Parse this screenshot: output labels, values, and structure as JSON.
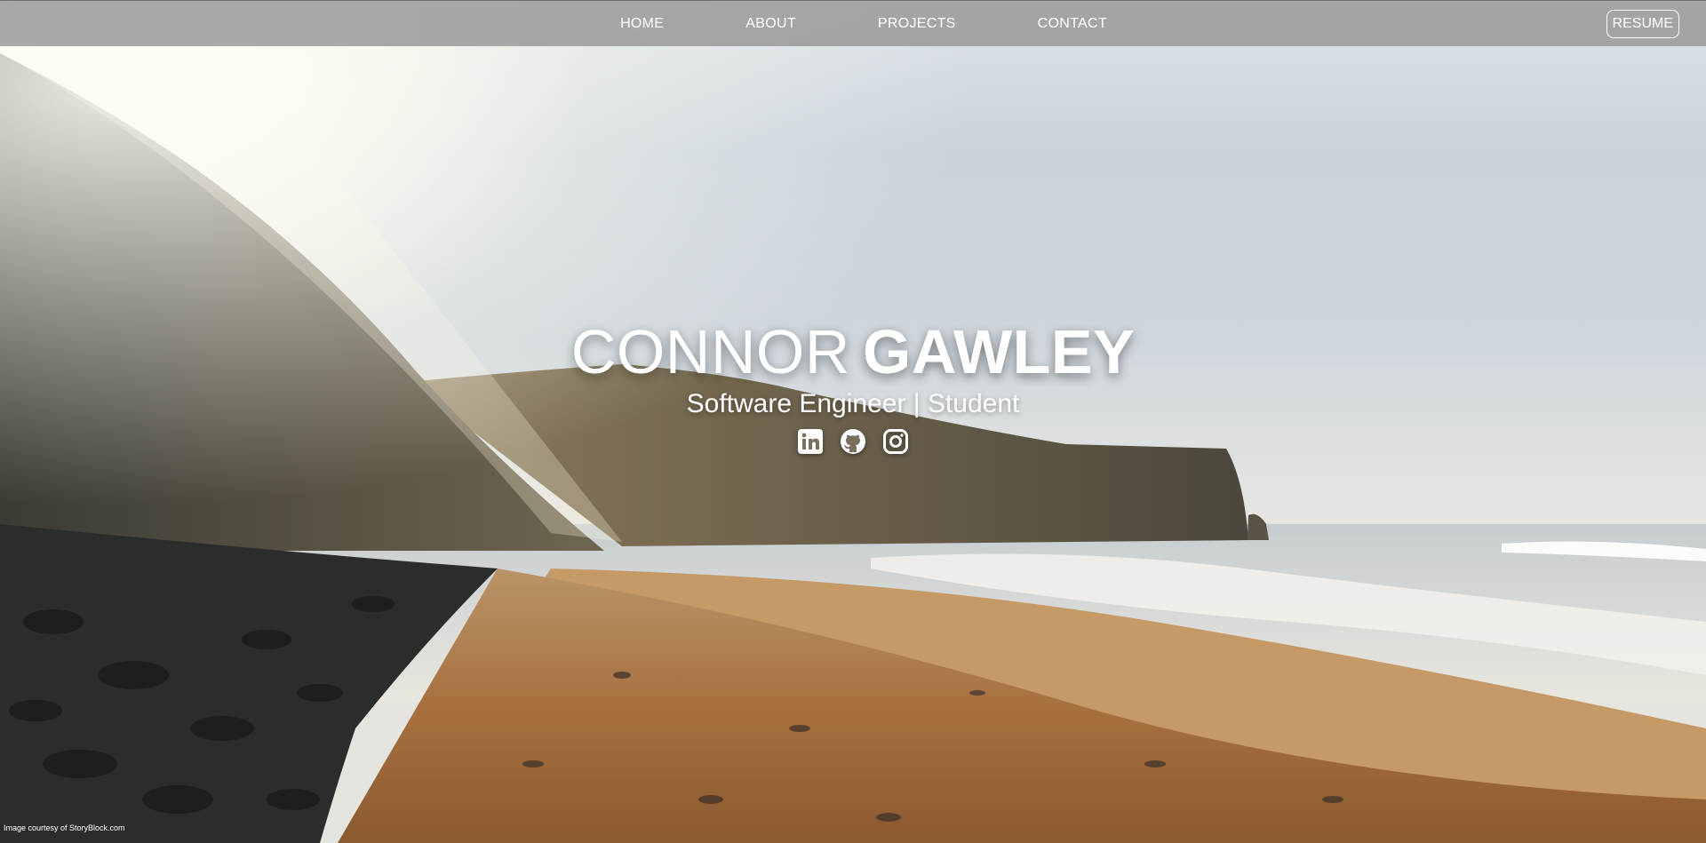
{
  "nav": {
    "links": [
      "HOME",
      "ABOUT",
      "PROJECTS",
      "CONTACT"
    ],
    "resume_label": "RESUME"
  },
  "hero": {
    "first_name": "CONNOR",
    "last_name": "GAWLEY",
    "subtitle": "Software Engineer | Student",
    "social_icons": [
      "linkedin-icon",
      "github-icon",
      "instagram-icon"
    ]
  },
  "footer": {
    "credit": "Image courtesy of StoryBlock.com"
  },
  "colors": {
    "nav_bg": "#969696",
    "text": "#ffffff"
  }
}
